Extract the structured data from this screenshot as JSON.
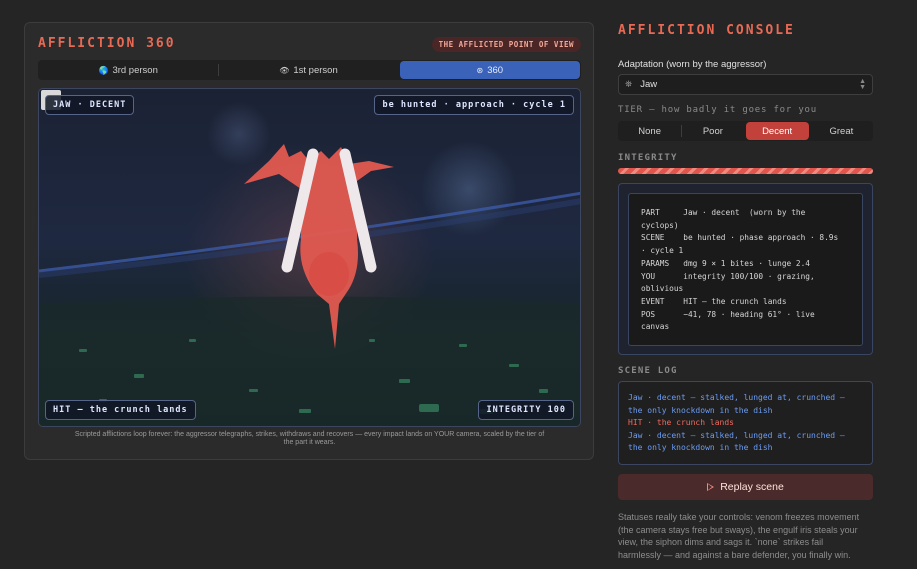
{
  "left": {
    "title": "AFFLICTION 360",
    "pov_badge": "THE AFFLICTED POINT OF VIEW",
    "view_tabs": [
      {
        "icon": "globe-icon",
        "glyph": "🌎",
        "label": "3rd person"
      },
      {
        "icon": "eye-icon",
        "glyph": "👁",
        "label": "1st person"
      },
      {
        "icon": "swirl-icon",
        "glyph": "⊛",
        "label": "360"
      }
    ],
    "active_view": "360",
    "hud": {
      "top_left": "JAW · DECENT",
      "top_right": "be hunted · approach · cycle 1",
      "bottom_left": "HIT — the crunch lands",
      "bottom_right": "INTEGRITY 100"
    },
    "caption_line1": "Scripted afflictions loop forever: the aggressor telegraphs, strikes, withdraws and recovers — every impact lands on YOUR camera, scaled by the tier of",
    "caption_line2": "the part it wears."
  },
  "console": {
    "title": "AFFLICTION CONSOLE",
    "adaptation_label": "Adaptation (worn by the aggressor)",
    "adaptation_icon": "bug-icon",
    "adaptation_value": "Jaw",
    "tier_label": "TIER — how badly it goes for you",
    "tiers": [
      "None",
      "Poor",
      "Decent",
      "Great"
    ],
    "active_tier": "Decent",
    "integrity_label": "INTEGRITY",
    "integrity_fraction": 1.0,
    "params_text": "PART     Jaw · decent  (worn by the\ncyclops)\nSCENE    be hunted · phase approach · 8.9s\n· cycle 1\nPARAMS   dmg 9 × 1 bites · lunge 2.4\nYOU      integrity 100/100 · grazing,\noblivious\nEVENT    HIT — the crunch lands\nPOS      −41, 78 · heading 61° · live\ncanvas",
    "log_label": "SCENE LOG",
    "log": [
      {
        "color": "blue",
        "text": "Jaw · decent — stalked, lunged at, crunched —"
      },
      {
        "color": "blue",
        "text": "the only knockdown in the dish"
      },
      {
        "color": "red",
        "text": "HIT · the crunch lands"
      },
      {
        "color": "blue",
        "text": "Jaw · decent — stalked, lunged at, crunched —"
      },
      {
        "color": "blue",
        "text": "the only knockdown in the dish"
      }
    ],
    "replay_label": "Replay scene",
    "footnote": "Statuses really take your controls: venom freezes movement (the camera stays free but sways), the engulf iris steals your view, the siphon dims and sags it. `none` strikes fail harmlessly — and against a bare defender, you finally win."
  },
  "colors": {
    "accent": "#e86a55",
    "active_view_tab": "#3a62b8",
    "active_tier": "#c2413a",
    "log_blue": "#6c9cf2",
    "log_red": "#ef6a5e"
  }
}
